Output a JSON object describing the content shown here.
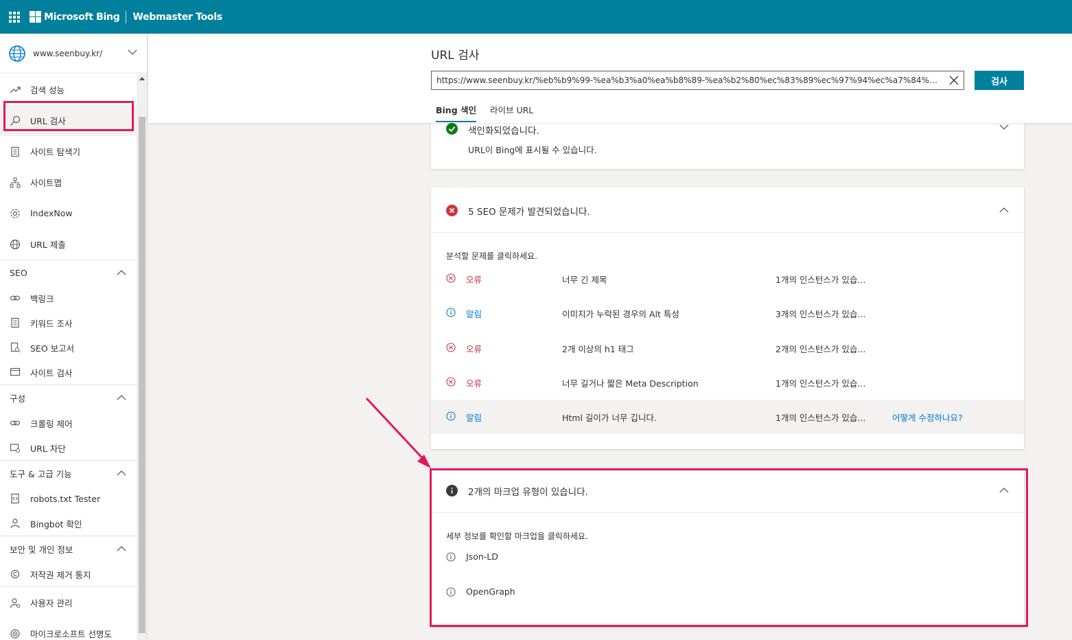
{
  "topbar": {
    "brand": "Microsoft Bing",
    "product": "Webmaster Tools",
    "brand_color": "#00809d"
  },
  "sidebar": {
    "site": "www.seenbuy.kr/",
    "items": [
      {
        "label": "검색 성능",
        "icon": "trend-icon"
      },
      {
        "label": "URL 검사",
        "icon": "search-icon",
        "active": true
      },
      {
        "label": "사이트 탐색기",
        "icon": "document-icon"
      },
      {
        "label": "사이트맵",
        "icon": "sitemap-icon"
      },
      {
        "label": "IndexNow",
        "icon": "gear-icon"
      },
      {
        "label": "URL 제출",
        "icon": "globe-icon"
      }
    ],
    "sections": [
      {
        "title": "SEO",
        "items": [
          "백링크",
          "키워드 조사",
          "SEO 보고서",
          "사이트 검사"
        ]
      },
      {
        "title": "구성",
        "items": [
          "크롤링 제어",
          "URL 차단"
        ]
      },
      {
        "title": "도구 & 고급 기능",
        "items": [
          "robots.txt Tester",
          "Bingbot 확인"
        ]
      },
      {
        "title": "보안 및 개인 정보",
        "items": [
          "저작권 제거 통지"
        ]
      }
    ],
    "bottom_items": [
      "사용자 관리",
      "마이크로소프트 선명도"
    ]
  },
  "header": {
    "title": "URL 검사",
    "url_value": "https://www.seenbuy.kr/%eb%b9%99-%ea%b3%a0%ea%b8%89-%ea%b2%80%ec%83%89%ec%97%94%ec%a7%84%ec%b5%9c...",
    "search_label": "검사",
    "tabs": [
      "Bing 색인",
      "라이브 URL"
    ]
  },
  "indexed_card": {
    "title": "색인화되었습니다.",
    "sub": "URL이 Bing에 표시될 수 있습니다."
  },
  "seo_card": {
    "title": "5 SEO 문제가 발견되었습니다.",
    "hint": "분석할 문제를 클릭하세요.",
    "rows": [
      {
        "severity": "오류",
        "type": "error",
        "desc": "너무 긴 제목",
        "count": "1개의 인스턴스가 있습..."
      },
      {
        "severity": "알림",
        "type": "info",
        "desc": "이미지가 누락된 경우의 Alt 특성",
        "count": "3개의 인스턴스가 있습..."
      },
      {
        "severity": "오류",
        "type": "error",
        "desc": "2개 이상의 h1 태그",
        "count": "2개의 인스턴스가 있습..."
      },
      {
        "severity": "오류",
        "type": "error",
        "desc": "너무 길거나 짧은 Meta Description",
        "count": "1개의 인스턴스가 있습..."
      },
      {
        "severity": "알림",
        "type": "info",
        "desc": "Html 길이가 너무 깁니다.",
        "count": "1개의 인스턴스가 있습...",
        "fix": "어떻게 수정하나요?"
      }
    ]
  },
  "markup_card": {
    "title": "2개의 마크업 유형이 있습니다.",
    "hint": "세부 정보를 확인할 마크업을 클릭하세요.",
    "items": [
      "Json-LD",
      "OpenGraph"
    ]
  },
  "annotation_color": "#e3185a"
}
